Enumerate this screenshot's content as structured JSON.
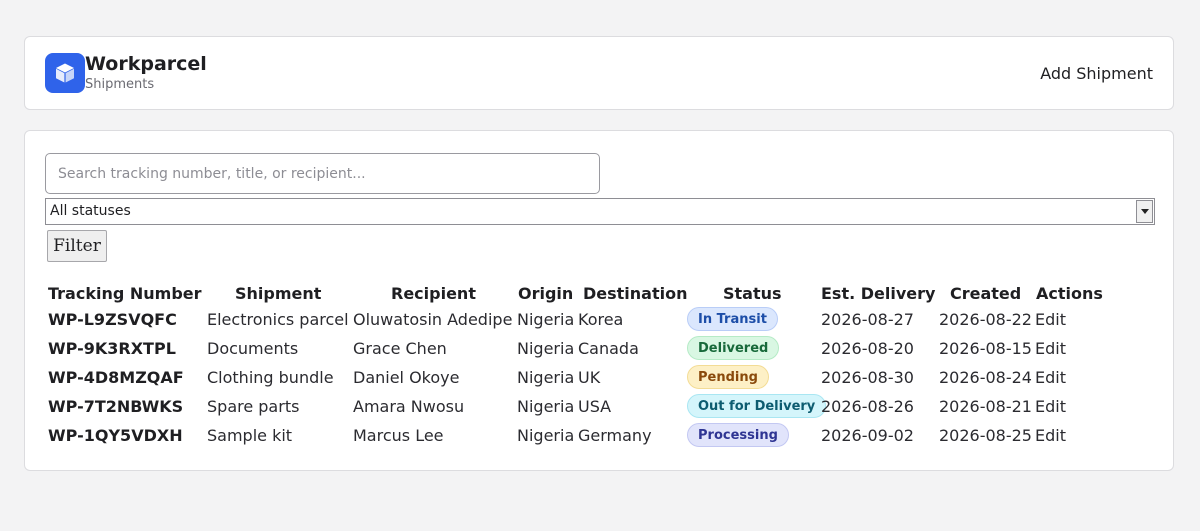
{
  "brand": {
    "name": "Workparcel",
    "subtitle": "Shipments"
  },
  "header": {
    "add_label": "Add Shipment"
  },
  "filters": {
    "search_placeholder": "Search tracking number, title, or recipient...",
    "status_selected": "All statuses",
    "filter_label": "Filter"
  },
  "table": {
    "headers": [
      "Tracking Number",
      "Shipment",
      "Recipient",
      "Origin",
      "Destination",
      "Status",
      "Est. Delivery",
      "Created",
      "Actions"
    ],
    "rows": [
      {
        "tracking": "WP-L9ZSVQFC",
        "shipment": "Electronics parcel",
        "recipient": "Oluwatosin Adedipe",
        "origin": "Nigeria",
        "destination": "Korea",
        "status": "In Transit",
        "est_delivery": "2026-08-27",
        "created": "2026-08-22",
        "action": "Edit"
      },
      {
        "tracking": "WP-9K3RXTPL",
        "shipment": "Documents",
        "recipient": "Grace Chen",
        "origin": "Nigeria",
        "destination": "Canada",
        "status": "Delivered",
        "est_delivery": "2026-08-20",
        "created": "2026-08-15",
        "action": "Edit"
      },
      {
        "tracking": "WP-4D8MZQAF",
        "shipment": "Clothing bundle",
        "recipient": "Daniel Okoye",
        "origin": "Nigeria",
        "destination": "UK",
        "status": "Pending",
        "est_delivery": "2026-08-30",
        "created": "2026-08-24",
        "action": "Edit"
      },
      {
        "tracking": "WP-7T2NBWKS",
        "shipment": "Spare parts",
        "recipient": "Amara Nwosu",
        "origin": "Nigeria",
        "destination": "USA",
        "status": "Out for Delivery",
        "est_delivery": "2026-08-26",
        "created": "2026-08-21",
        "action": "Edit"
      },
      {
        "tracking": "WP-1QY5VDXH",
        "shipment": "Sample kit",
        "recipient": "Marcus Lee",
        "origin": "Nigeria",
        "destination": "Germany",
        "status": "Processing",
        "est_delivery": "2026-09-02",
        "created": "2026-08-25",
        "action": "Edit"
      }
    ]
  },
  "status_colors": {
    "In Transit": {
      "bg": "#dbe7fd",
      "fg": "#1d4ea8",
      "border": "#b9cdf7"
    },
    "Delivered": {
      "bg": "#d9f7e3",
      "fg": "#17693a",
      "border": "#b5ebc6"
    },
    "Pending": {
      "bg": "#fdf0c6",
      "fg": "#8a4a0c",
      "border": "#f3dc95"
    },
    "Out for Delivery": {
      "bg": "#d4f5fb",
      "fg": "#0d5c70",
      "border": "#a9e6f2"
    },
    "Processing": {
      "bg": "#e1e4fb",
      "fg": "#2f3593",
      "border": "#c3c8f2"
    }
  },
  "theme": {
    "accent": "#2f63ea"
  },
  "icons": {
    "logo": "box-icon",
    "select": "chevron-down-icon"
  }
}
